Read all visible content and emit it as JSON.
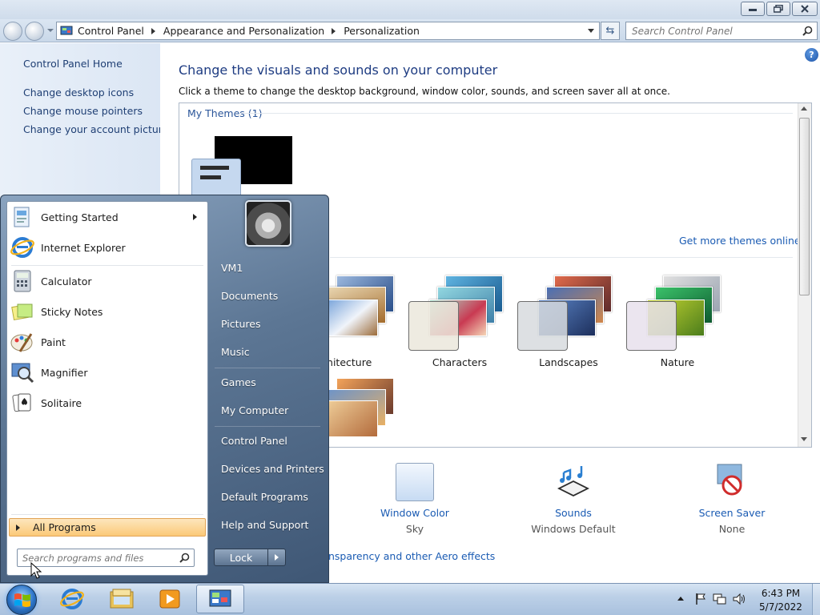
{
  "window": {
    "breadcrumb": [
      "Control Panel",
      "Appearance and Personalization",
      "Personalization"
    ],
    "search_placeholder": "Search Control Panel"
  },
  "sidebar": {
    "home": "Control Panel Home",
    "links": [
      "Change desktop icons",
      "Change mouse pointers",
      "Change your account picture"
    ]
  },
  "main": {
    "title": "Change the visuals and sounds on your computer",
    "subtitle": "Click a theme to change the desktop background, window color, sounds, and screen saver all at once.",
    "my_themes": "My Themes (1)",
    "get_more": "Get more themes online",
    "themes": [
      "Architecture",
      "Characters",
      "Landscapes",
      "Nature"
    ],
    "settings": [
      {
        "label": "Window Color",
        "value": "Sky"
      },
      {
        "label": "Sounds",
        "value": "Windows Default"
      },
      {
        "label": "Screen Saver",
        "value": "None"
      }
    ],
    "aero_link": "nsparency and other Aero effects"
  },
  "start_menu": {
    "programs": [
      "Getting Started",
      "Internet Explorer",
      "Calculator",
      "Sticky Notes",
      "Paint",
      "Magnifier",
      "Solitaire"
    ],
    "all_programs": "All Programs",
    "search_placeholder": "Search programs and files",
    "right_items": [
      "VM1",
      "Documents",
      "Pictures",
      "Music",
      "Games",
      "My Computer",
      "Control Panel",
      "Devices and Printers",
      "Default Programs",
      "Help and Support"
    ],
    "lock": "Lock"
  },
  "taskbar": {
    "time": "6:43 PM",
    "date": "5/7/2022"
  },
  "icons": {
    "help": "?",
    "refresh": "⇆"
  },
  "colors": {
    "link": "#1a5bb3",
    "title": "#1e3c82",
    "all_programs_highlight": "#fbc978"
  }
}
